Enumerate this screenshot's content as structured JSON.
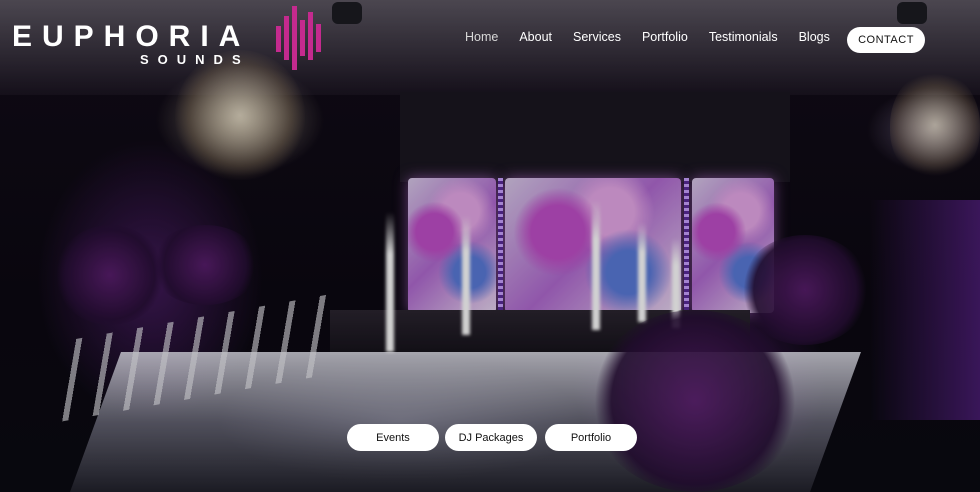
{
  "brand": {
    "name": "EUPHORIA",
    "tagline": "SOUNDS"
  },
  "nav": {
    "items": [
      {
        "label": "Home",
        "active": true
      },
      {
        "label": "About",
        "active": false
      },
      {
        "label": "Services",
        "active": false
      },
      {
        "label": "Portfolio",
        "active": false
      },
      {
        "label": "Testimonials",
        "active": false
      },
      {
        "label": "Blogs",
        "active": false
      }
    ],
    "cta_label": "CONTACT"
  },
  "hero": {
    "buttons": [
      {
        "label": "Events"
      },
      {
        "label": "DJ Packages"
      },
      {
        "label": "Portfolio"
      }
    ]
  },
  "colors": {
    "brand_magenta": "#c42a8e",
    "text": "#ffffff",
    "button_bg": "#ffffff"
  }
}
